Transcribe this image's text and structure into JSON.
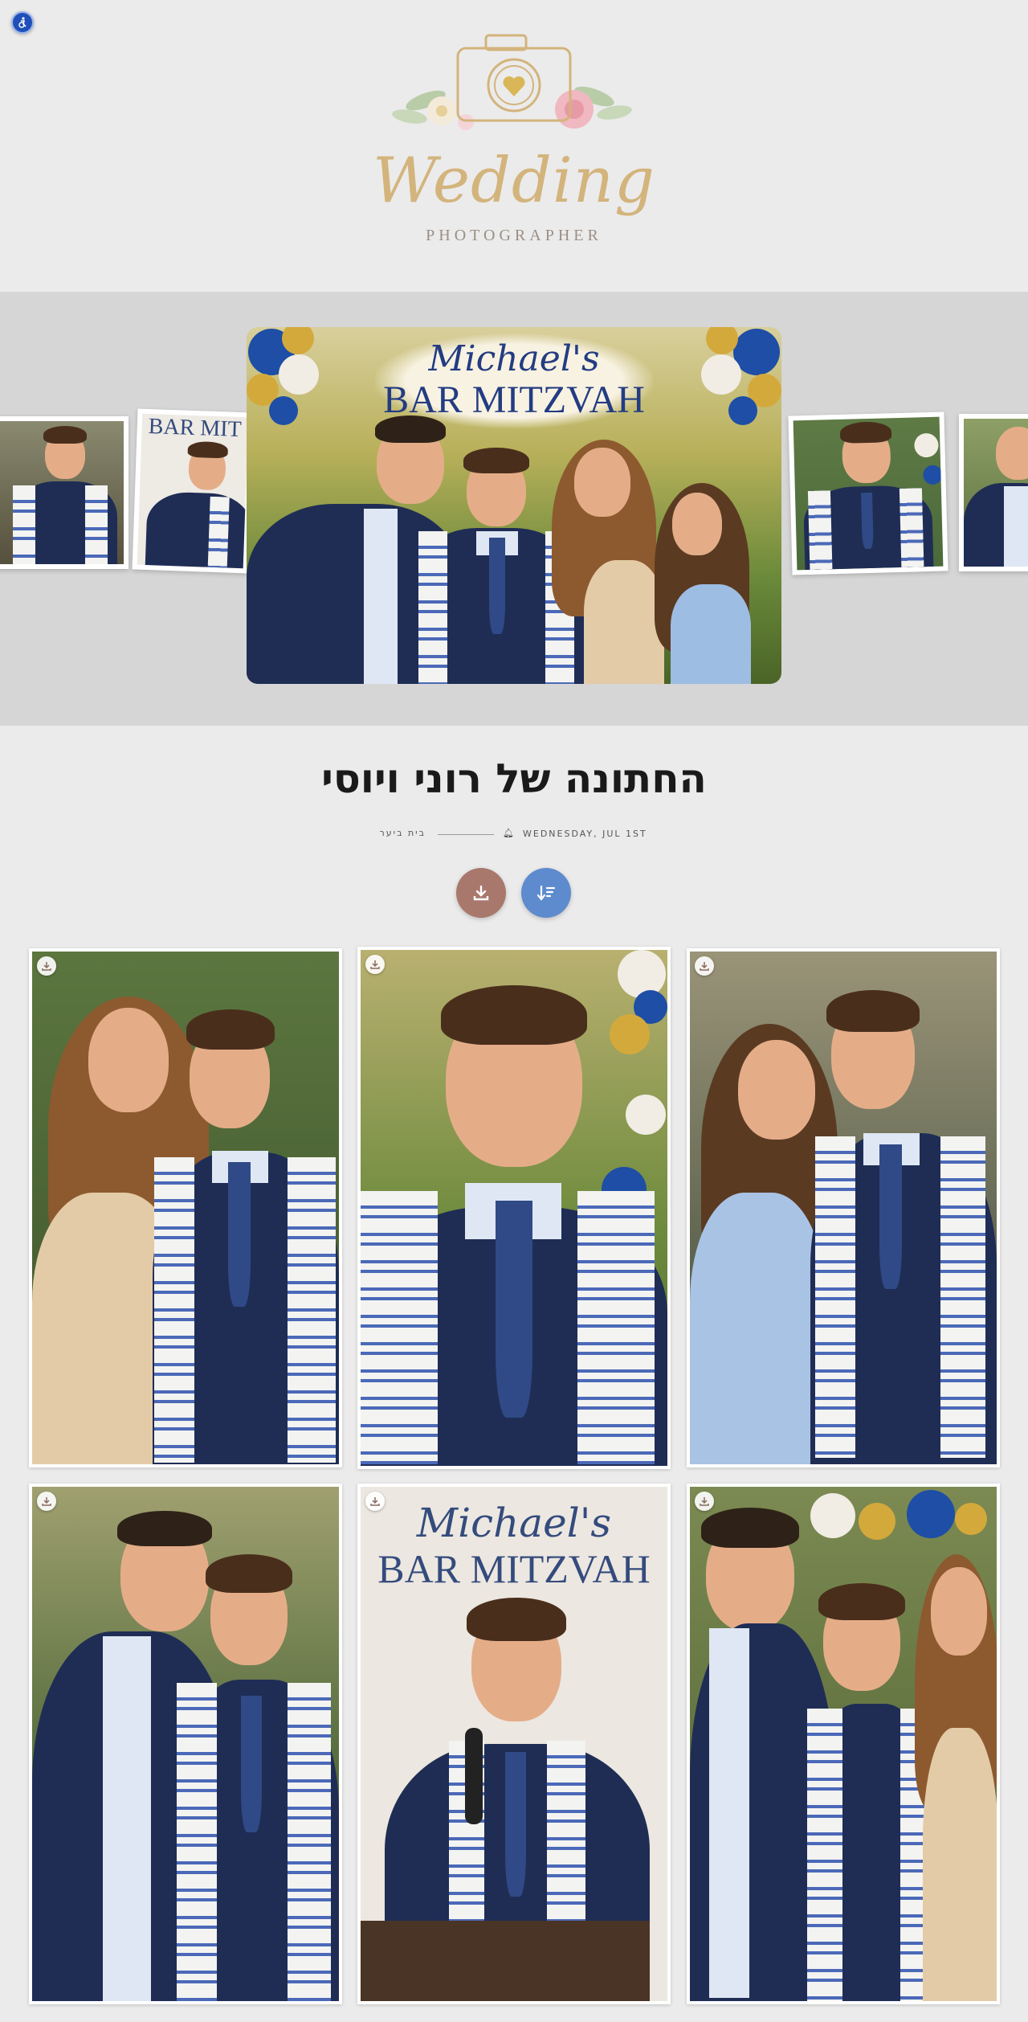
{
  "accessibility": {
    "icon": "accessibility-icon"
  },
  "logo": {
    "word": "Wedding",
    "sub": "PHOTOGRAPHER",
    "icon": "camera-heart-icon"
  },
  "hero": {
    "banner_line1": "Michael's",
    "banner_line2": "BAR MITZVAH",
    "side_label": "BAR MIT"
  },
  "event": {
    "title": "החתונה של רוני ויוסי",
    "venue": "בית ביער",
    "date": "WEDNESDAY, JUL 1ST",
    "bell_icon": "bell-icon"
  },
  "actions": {
    "download_icon": "download-icon",
    "sort_icon": "sort-icon"
  },
  "gallery": {
    "tile_banner_line1": "Michael's",
    "tile_banner_line2": "BAR MITZVAH"
  },
  "colors": {
    "logo_gold": "#d3b47c",
    "download_btn": "#a9786c",
    "sort_btn": "#5d8bce",
    "navy": "#233c82"
  }
}
